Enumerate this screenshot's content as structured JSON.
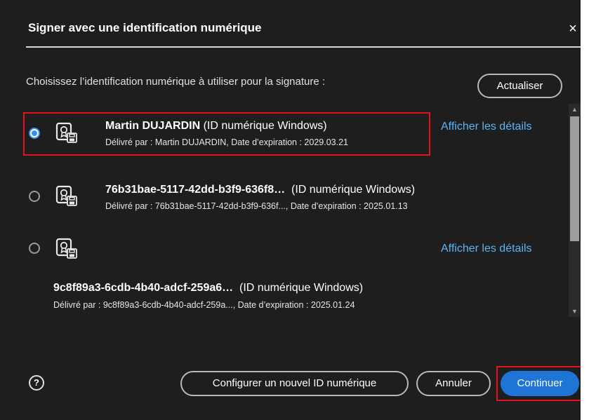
{
  "dialog": {
    "title": "Signer avec une identification numérique",
    "close_label": "×",
    "instruction": "Choisissez l’identification numérique à utiliser pour la signature :",
    "refresh_label": "Actualiser"
  },
  "certificates": [
    {
      "name": "Martin DUJARDIN",
      "type": "(ID numérique Windows)",
      "detail": "Délivré par : Martin DUJARDIN, Date d’expiration : 2029.03.21",
      "details_link": "Afficher les détails",
      "selected": true
    },
    {
      "name": "76b31bae-5117-42dd-b3f9-636f8…",
      "type": "(ID numérique Windows)",
      "detail": "Délivré par : 76b31bae-5117-42dd-b3f9-636f..., Date d’expiration : 2025.01.13",
      "selected": false
    },
    {
      "name": "9c8f89a3-6cdb-4b40-adcf-259a6…",
      "type": "(ID numérique Windows)",
      "detail": "Délivré par : 9c8f89a3-6cdb-4b40-adcf-259a..., Date d’expiration : 2025.01.24",
      "details_link": "Afficher les détails",
      "selected": false
    }
  ],
  "footer": {
    "help_label": "?",
    "configure_label": "Configurer un nouvel ID numérique",
    "cancel_label": "Annuler",
    "continue_label": "Continuer"
  },
  "icons": {
    "certificate": "certificate-icon",
    "close": "close-icon",
    "help": "help-icon"
  },
  "colors": {
    "background": "#1e1e1e",
    "accent": "#1f75d6",
    "link": "#58b4f5",
    "highlight": "#e8101a"
  }
}
